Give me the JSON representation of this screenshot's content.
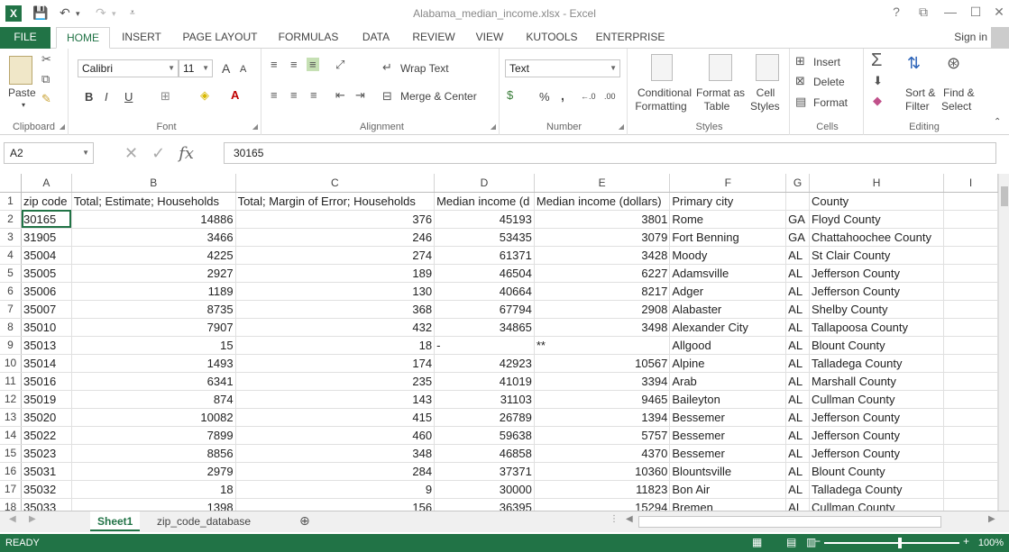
{
  "window": {
    "title": "Alabama_median_income.xlsx - Excel",
    "app_icon": "X",
    "help": "?",
    "restore": "⧉",
    "minimize": "—",
    "maximize": "☐",
    "close": "✕"
  },
  "ribbon_tabs": [
    "FILE",
    "HOME",
    "INSERT",
    "PAGE LAYOUT",
    "FORMULAS",
    "DATA",
    "REVIEW",
    "VIEW",
    "KUTOOLS",
    "ENTERPRISE"
  ],
  "active_tab": "HOME",
  "sign_in": "Sign in",
  "ribbon": {
    "clipboard": {
      "paste": "Paste",
      "label": "Clipboard"
    },
    "font": {
      "name": "Calibri",
      "size": "11",
      "bold": "B",
      "italic": "I",
      "underline": "U",
      "grow": "A",
      "shrink": "A",
      "label": "Font"
    },
    "alignment": {
      "wrap_text": "Wrap Text",
      "merge_center": "Merge & Center",
      "label": "Alignment"
    },
    "number": {
      "format": "Text",
      "percent": "%",
      "comma": ",",
      "inc_dec": "←.0",
      "dec_dec": ".00",
      "label": "Number"
    },
    "styles": {
      "conditional_1": "Conditional",
      "conditional_2": "Formatting",
      "format_table_1": "Format as",
      "format_table_2": "Table",
      "cell_styles_1": "Cell",
      "cell_styles_2": "Styles",
      "label": "Styles"
    },
    "cells": {
      "insert": "Insert",
      "delete": "Delete",
      "format": "Format",
      "label": "Cells"
    },
    "editing": {
      "sort_1": "Sort &",
      "sort_2": "Filter",
      "find_1": "Find &",
      "find_2": "Select",
      "label": "Editing"
    }
  },
  "formula_bar": {
    "name_box": "A2",
    "value": "30165"
  },
  "columns": [
    "A",
    "B",
    "C",
    "D",
    "E",
    "F",
    "G",
    "H",
    "I"
  ],
  "rows": [
    {
      "n": "1",
      "cells": [
        "zip code",
        "Total; Estimate; Households",
        "Total; Margin of Error; Households",
        "Median income (d",
        "Median income (dollars)",
        "Primary city",
        "",
        "County",
        ""
      ]
    },
    {
      "n": "2",
      "cells": [
        "30165",
        "14886",
        "376",
        "45193",
        "3801",
        "Rome",
        "GA",
        "Floyd County",
        ""
      ]
    },
    {
      "n": "3",
      "cells": [
        "31905",
        "3466",
        "246",
        "53435",
        "3079",
        "Fort Benning",
        "GA",
        "Chattahoochee County",
        ""
      ]
    },
    {
      "n": "4",
      "cells": [
        "35004",
        "4225",
        "274",
        "61371",
        "3428",
        "Moody",
        "AL",
        "St Clair County",
        ""
      ]
    },
    {
      "n": "5",
      "cells": [
        "35005",
        "2927",
        "189",
        "46504",
        "6227",
        "Adamsville",
        "AL",
        "Jefferson County",
        ""
      ]
    },
    {
      "n": "6",
      "cells": [
        "35006",
        "1189",
        "130",
        "40664",
        "8217",
        "Adger",
        "AL",
        "Jefferson County",
        ""
      ]
    },
    {
      "n": "7",
      "cells": [
        "35007",
        "8735",
        "368",
        "67794",
        "2908",
        "Alabaster",
        "AL",
        "Shelby County",
        ""
      ]
    },
    {
      "n": "8",
      "cells": [
        "35010",
        "7907",
        "432",
        "34865",
        "3498",
        "Alexander City",
        "AL",
        "Tallapoosa County",
        ""
      ]
    },
    {
      "n": "9",
      "cells": [
        "35013",
        "15",
        "18",
        "-",
        "**",
        "Allgood",
        "AL",
        "Blount County",
        ""
      ]
    },
    {
      "n": "10",
      "cells": [
        "35014",
        "1493",
        "174",
        "42923",
        "10567",
        "Alpine",
        "AL",
        "Talladega County",
        ""
      ]
    },
    {
      "n": "11",
      "cells": [
        "35016",
        "6341",
        "235",
        "41019",
        "3394",
        "Arab",
        "AL",
        "Marshall County",
        ""
      ]
    },
    {
      "n": "12",
      "cells": [
        "35019",
        "874",
        "143",
        "31103",
        "9465",
        "Baileyton",
        "AL",
        "Cullman County",
        ""
      ]
    },
    {
      "n": "13",
      "cells": [
        "35020",
        "10082",
        "415",
        "26789",
        "1394",
        "Bessemer",
        "AL",
        "Jefferson County",
        ""
      ]
    },
    {
      "n": "14",
      "cells": [
        "35022",
        "7899",
        "460",
        "59638",
        "5757",
        "Bessemer",
        "AL",
        "Jefferson County",
        ""
      ]
    },
    {
      "n": "15",
      "cells": [
        "35023",
        "8856",
        "348",
        "46858",
        "4370",
        "Bessemer",
        "AL",
        "Jefferson County",
        ""
      ]
    },
    {
      "n": "16",
      "cells": [
        "35031",
        "2979",
        "284",
        "37371",
        "10360",
        "Blountsville",
        "AL",
        "Blount County",
        ""
      ]
    },
    {
      "n": "17",
      "cells": [
        "35032",
        "18",
        "9",
        "30000",
        "11823",
        "Bon Air",
        "AL",
        "Talladega County",
        ""
      ]
    },
    {
      "n": "18",
      "cells": [
        "35033",
        "1398",
        "156",
        "36395",
        "15294",
        "Bremen",
        "AL",
        "Cullman County",
        ""
      ]
    }
  ],
  "sheet_tabs": [
    "Sheet1",
    "zip_code_database"
  ],
  "active_sheet": "Sheet1",
  "status": {
    "ready": "READY",
    "zoom": "100%"
  }
}
